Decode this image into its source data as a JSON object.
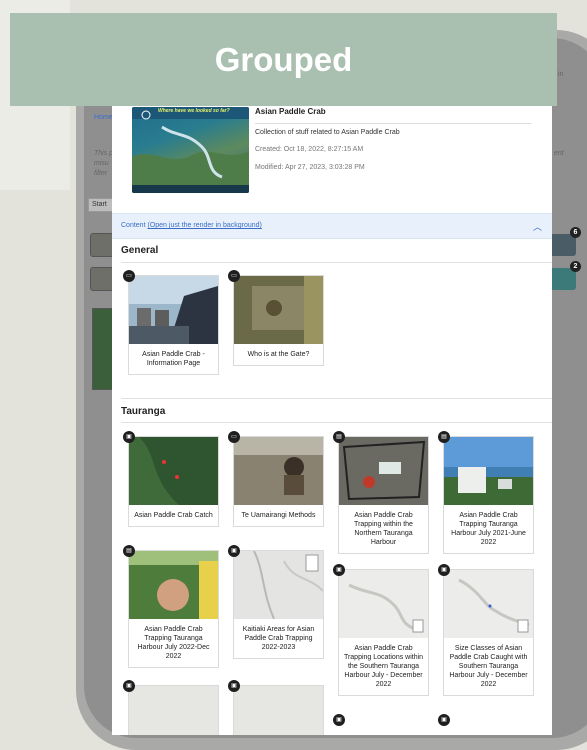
{
  "banner": {
    "title": "Grouped"
  },
  "background": {
    "home_link": "Home",
    "faint_left_1": "This p",
    "faint_left_2": "misu",
    "faint_left_3": "filter",
    "faint_right_1": "ent",
    "corner_text": "in",
    "start_label": "Start",
    "right_badges": [
      "6",
      "2"
    ]
  },
  "header": {
    "title": "Asian Paddle Crab",
    "description": "Collection of stuff related to Asian Paddle Crab",
    "created": "Created: Oct 18, 2022, 8:27:15 AM",
    "modified": "Modified: Apr 27, 2023, 3:03:28 PM",
    "thumb_caption": "Where have we looked so far?"
  },
  "content_bar": {
    "prefix": "Content",
    "link": "(Open just the render in background)"
  },
  "sections": [
    {
      "title": "General",
      "items": [
        {
          "label": "Asian Paddle Crab - Information Page",
          "icon": "story-icon"
        },
        {
          "label": "Who is at the Gate?",
          "icon": "story-icon"
        }
      ]
    },
    {
      "title": "Tauranga",
      "items": [
        {
          "label": "Asian Paddle Crab Catch",
          "icon": "map-icon"
        },
        {
          "label": "Te Uamairangi Methods",
          "icon": "story-icon"
        },
        {
          "label": "Asian Paddle Crab Trapping within the Northern Tauranga Harbour",
          "icon": "document-icon"
        },
        {
          "label": "Asian Paddle Crab Trapping Tauranga Harbour July 2021-June 2022",
          "icon": "document-icon"
        },
        {
          "label": "Asian Paddle Crab Trapping Tauranga Harbour July 2022-Dec 2022",
          "icon": "document-icon"
        },
        {
          "label": "Kaitiaki Areas for Asian Paddle Crab Trapping 2022-2023",
          "icon": "map-icon"
        },
        {
          "label": "Asian Paddle Crab Trapping Locations within the Southern Tauranga Harbour July - December 2022",
          "icon": "map-icon"
        },
        {
          "label": "Size Classes of Asian Paddle Crab Caught with Southern Tauranga Harbour July - December 2022",
          "icon": "map-icon"
        }
      ]
    }
  ]
}
